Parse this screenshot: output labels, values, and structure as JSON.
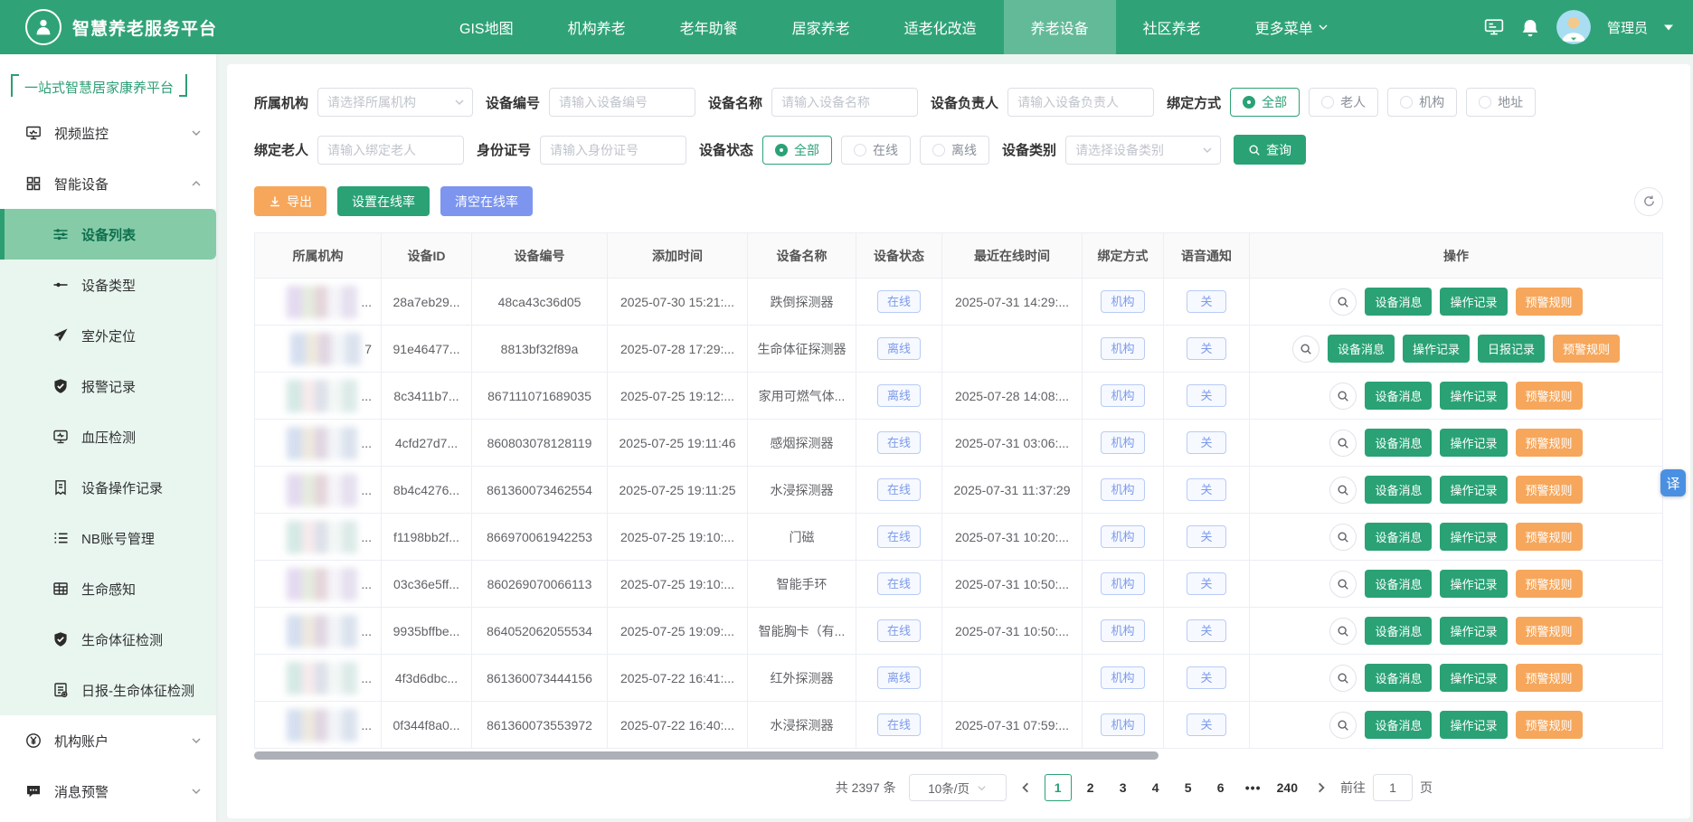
{
  "colors": {
    "navbar_green": "#2fa377",
    "accent_green": "#2aa275",
    "sidebar_active_bg": "#86cba8",
    "orange": "#f6a75c",
    "periwinkle_blue": "#7d95ee",
    "badge_blue": "#7d9beb",
    "fab_blue": "#4a90e2"
  },
  "topnav": {
    "brand": "智慧养老服务平台",
    "items": [
      {
        "label": "GIS地图",
        "active": false
      },
      {
        "label": "机构养老",
        "active": false
      },
      {
        "label": "老年助餐",
        "active": false
      },
      {
        "label": "居家养老",
        "active": false
      },
      {
        "label": "适老化改造",
        "active": false
      },
      {
        "label": "养老设备",
        "active": true
      },
      {
        "label": "社区养老",
        "active": false
      },
      {
        "label": "更多菜单",
        "active": false,
        "dropdown": true
      }
    ],
    "user_name": "管理员"
  },
  "sidebar": {
    "title": "一站式智慧居家康养平台",
    "menu": [
      {
        "label": "视频监控",
        "icon": "monitor",
        "chevron": "down"
      },
      {
        "label": "智能设备",
        "icon": "grid",
        "chevron": "up",
        "expanded": true,
        "children": [
          {
            "label": "设备列表",
            "icon": "sliders",
            "active": true
          },
          {
            "label": "设备类型",
            "icon": "plug",
            "active": false
          },
          {
            "label": "室外定位",
            "icon": "plane",
            "active": false
          },
          {
            "label": "报警记录",
            "icon": "shield",
            "active": false
          },
          {
            "label": "血压检测",
            "icon": "bp",
            "active": false
          },
          {
            "label": "设备操作记录",
            "icon": "doc",
            "active": false
          },
          {
            "label": "NB账号管理",
            "icon": "list",
            "active": false
          },
          {
            "label": "生命感知",
            "icon": "tableic",
            "active": false
          },
          {
            "label": "生命体征检测",
            "icon": "shield",
            "active": false
          },
          {
            "label": "日报-生命体征检测",
            "icon": "report",
            "active": false
          }
        ]
      },
      {
        "label": "机构账户",
        "icon": "yen",
        "chevron": "down"
      },
      {
        "label": "消息预警",
        "icon": "msg",
        "chevron": "down"
      }
    ]
  },
  "filters": {
    "org": {
      "label": "所属机构",
      "placeholder": "请选择所属机构"
    },
    "device_no": {
      "label": "设备编号",
      "placeholder": "请输入设备编号"
    },
    "device_name": {
      "label": "设备名称",
      "placeholder": "请输入设备名称"
    },
    "device_owner": {
      "label": "设备负责人",
      "placeholder": "请输入设备负责人"
    },
    "bind_mode": {
      "label": "绑定方式",
      "options": [
        "全部",
        "老人",
        "机构",
        "地址"
      ],
      "selected": "全部"
    },
    "bind_elder": {
      "label": "绑定老人",
      "placeholder": "请输入绑定老人"
    },
    "id_card": {
      "label": "身份证号",
      "placeholder": "请输入身份证号"
    },
    "device_status": {
      "label": "设备状态",
      "options": [
        "全部",
        "在线",
        "离线"
      ],
      "selected": "全部"
    },
    "device_type": {
      "label": "设备类别",
      "placeholder": "请选择设备类别"
    },
    "search_label": "查询"
  },
  "toolbar": {
    "export_label": "导出",
    "set_rate_label": "设置在线率",
    "clear_rate_label": "清空在线率"
  },
  "table": {
    "columns": [
      "所属机构",
      "设备ID",
      "设备编号",
      "添加时间",
      "设备名称",
      "设备状态",
      "最近在线时间",
      "绑定方式",
      "语音通知",
      "操作"
    ],
    "rows": [
      {
        "org_suffix": "...",
        "device_id": "28a7eb29...",
        "device_no": "48ca43c36d05",
        "added": "2025-07-30 15:21:...",
        "name": "跌倒探测器",
        "status": "在线",
        "last_online": "2025-07-31 14:29:...",
        "bind": "机构",
        "voice": "关",
        "ops": [
          {
            "label": "设备消息",
            "color": "green"
          },
          {
            "label": "操作记录",
            "color": "green"
          },
          {
            "label": "预警规则",
            "color": "orange"
          }
        ]
      },
      {
        "org_suffix": "7",
        "device_id": "91e46477...",
        "device_no": "8813bf32f89a",
        "added": "2025-07-28 17:29:...",
        "name": "生命体征探测器",
        "status": "离线",
        "last_online": "",
        "bind": "机构",
        "voice": "关",
        "ops": [
          {
            "label": "设备消息",
            "color": "green"
          },
          {
            "label": "操作记录",
            "color": "green"
          },
          {
            "label": "日报记录",
            "color": "green"
          },
          {
            "label": "预警规则",
            "color": "orange"
          }
        ]
      },
      {
        "org_suffix": "...",
        "device_id": "8c3411b7...",
        "device_no": "867111071689035",
        "added": "2025-07-25 19:12:...",
        "name": "家用可燃气体...",
        "status": "离线",
        "last_online": "2025-07-28 14:08:...",
        "bind": "机构",
        "voice": "关",
        "ops": [
          {
            "label": "设备消息",
            "color": "green"
          },
          {
            "label": "操作记录",
            "color": "green"
          },
          {
            "label": "预警规则",
            "color": "orange"
          }
        ]
      },
      {
        "org_suffix": "...",
        "device_id": "4cfd27d7...",
        "device_no": "860803078128119",
        "added": "2025-07-25 19:11:46",
        "name": "感烟探测器",
        "status": "在线",
        "last_online": "2025-07-31 03:06:...",
        "bind": "机构",
        "voice": "关",
        "ops": [
          {
            "label": "设备消息",
            "color": "green"
          },
          {
            "label": "操作记录",
            "color": "green"
          },
          {
            "label": "预警规则",
            "color": "orange"
          }
        ]
      },
      {
        "org_suffix": "...",
        "device_id": "8b4c4276...",
        "device_no": "861360073462554",
        "added": "2025-07-25 19:11:25",
        "name": "水浸探测器",
        "status": "在线",
        "last_online": "2025-07-31 11:37:29",
        "bind": "机构",
        "voice": "关",
        "ops": [
          {
            "label": "设备消息",
            "color": "green"
          },
          {
            "label": "操作记录",
            "color": "green"
          },
          {
            "label": "预警规则",
            "color": "orange"
          }
        ]
      },
      {
        "org_suffix": "...",
        "device_id": "f1198bb2f...",
        "device_no": "866970061942253",
        "added": "2025-07-25 19:10:...",
        "name": "门磁",
        "status": "在线",
        "last_online": "2025-07-31 10:20:...",
        "bind": "机构",
        "voice": "关",
        "ops": [
          {
            "label": "设备消息",
            "color": "green"
          },
          {
            "label": "操作记录",
            "color": "green"
          },
          {
            "label": "预警规则",
            "color": "orange"
          }
        ]
      },
      {
        "org_suffix": "...",
        "device_id": "03c36e5ff...",
        "device_no": "860269070066113",
        "added": "2025-07-25 19:10:...",
        "name": "智能手环",
        "status": "在线",
        "last_online": "2025-07-31 10:50:...",
        "bind": "机构",
        "voice": "关",
        "ops": [
          {
            "label": "设备消息",
            "color": "green"
          },
          {
            "label": "操作记录",
            "color": "green"
          },
          {
            "label": "预警规则",
            "color": "orange"
          }
        ]
      },
      {
        "org_suffix": "...",
        "device_id": "9935bffbe...",
        "device_no": "864052062055534",
        "added": "2025-07-25 19:09:...",
        "name": "智能胸卡（有...",
        "status": "在线",
        "last_online": "2025-07-31 10:50:...",
        "bind": "机构",
        "voice": "关",
        "ops": [
          {
            "label": "设备消息",
            "color": "green"
          },
          {
            "label": "操作记录",
            "color": "green"
          },
          {
            "label": "预警规则",
            "color": "orange"
          }
        ]
      },
      {
        "org_suffix": "...",
        "device_id": "4f3d6dbc...",
        "device_no": "861360073444156",
        "added": "2025-07-22 16:41:...",
        "name": "红外探测器",
        "status": "离线",
        "last_online": "",
        "bind": "机构",
        "voice": "关",
        "ops": [
          {
            "label": "设备消息",
            "color": "green"
          },
          {
            "label": "操作记录",
            "color": "green"
          },
          {
            "label": "预警规则",
            "color": "orange"
          }
        ]
      },
      {
        "org_suffix": "...",
        "device_id": "0f344f8a0...",
        "device_no": "861360073553972",
        "added": "2025-07-22 16:40:...",
        "name": "水浸探测器",
        "status": "在线",
        "last_online": "2025-07-31 07:59:...",
        "bind": "机构",
        "voice": "关",
        "ops": [
          {
            "label": "设备消息",
            "color": "green"
          },
          {
            "label": "操作记录",
            "color": "green"
          },
          {
            "label": "预警规则",
            "color": "orange"
          }
        ]
      }
    ]
  },
  "pagination": {
    "total_text": "共 2397 条",
    "page_size": "10条/页",
    "pages": [
      "1",
      "2",
      "3",
      "4",
      "5",
      "6",
      "...",
      "240"
    ],
    "active_page": "1",
    "jump_prefix": "前往",
    "jump_value": "1",
    "jump_suffix": "页"
  },
  "fab": {
    "label": "译"
  }
}
